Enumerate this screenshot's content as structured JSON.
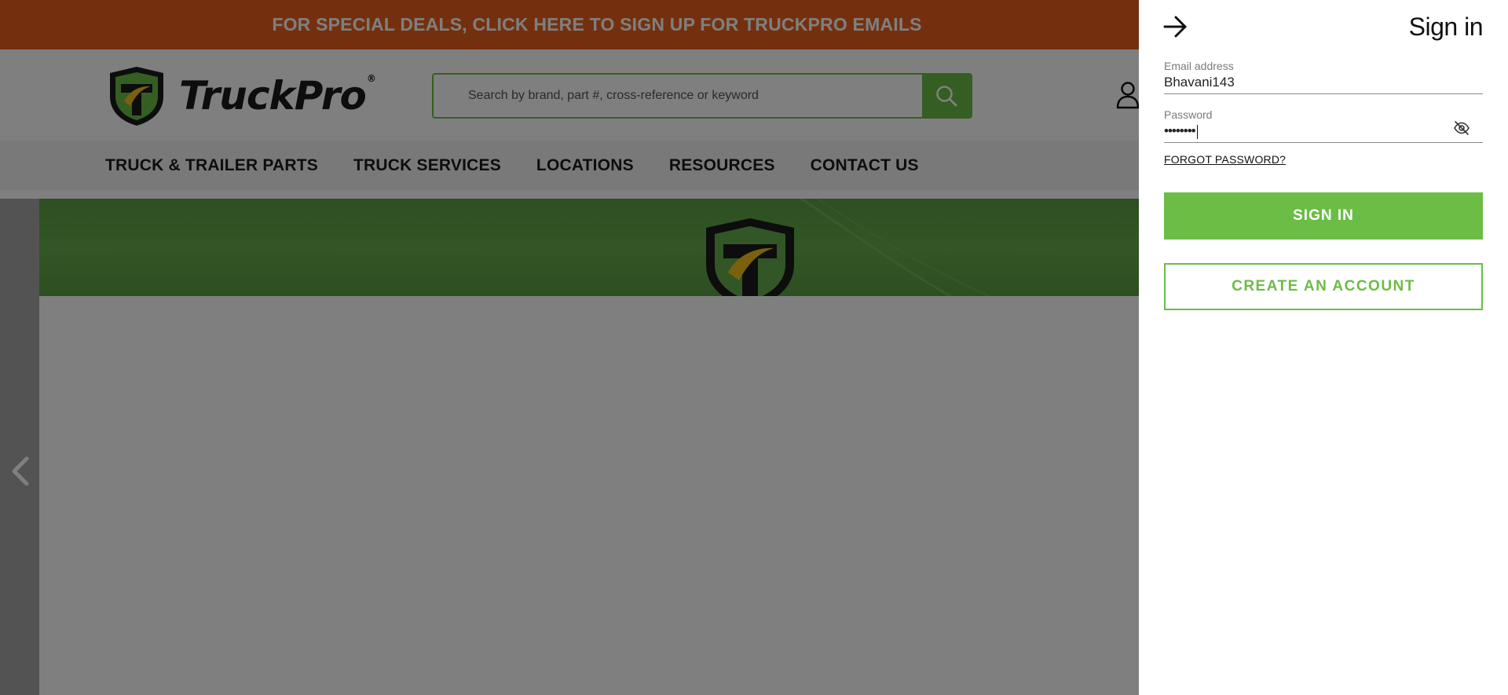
{
  "promo": {
    "text": "FOR SPECIAL DEALS, CLICK HERE TO SIGN UP FOR TRUCKPRO EMAILS"
  },
  "header": {
    "logo_text": "TruckPro",
    "logo_reg": "®",
    "search_placeholder": "Search by brand, part #, cross-reference or keyword"
  },
  "nav": {
    "items": [
      "TRUCK & TRAILER PARTS",
      "TRUCK SERVICES",
      "LOCATIONS",
      "RESOURCES",
      "CONTACT US"
    ]
  },
  "signin": {
    "title": "Sign in",
    "email_label": "Email address",
    "email_value": "Bhavani143",
    "password_label": "Password",
    "password_value": "••••••••",
    "forgot_label": "FORGOT PASSWORD?",
    "signin_button": "SIGN IN",
    "create_button": "CREATE AN ACCOUNT"
  },
  "colors": {
    "promo_orange": "#e8601c",
    "brand_green": "#6bbd45",
    "overlay": "rgba(0,0,0,0.5)"
  },
  "icons": {
    "search": "search-icon",
    "account": "user-icon",
    "close": "arrow-right-icon",
    "password_toggle": "eye-slash-icon",
    "slider_prev": "chevron-left-icon"
  }
}
